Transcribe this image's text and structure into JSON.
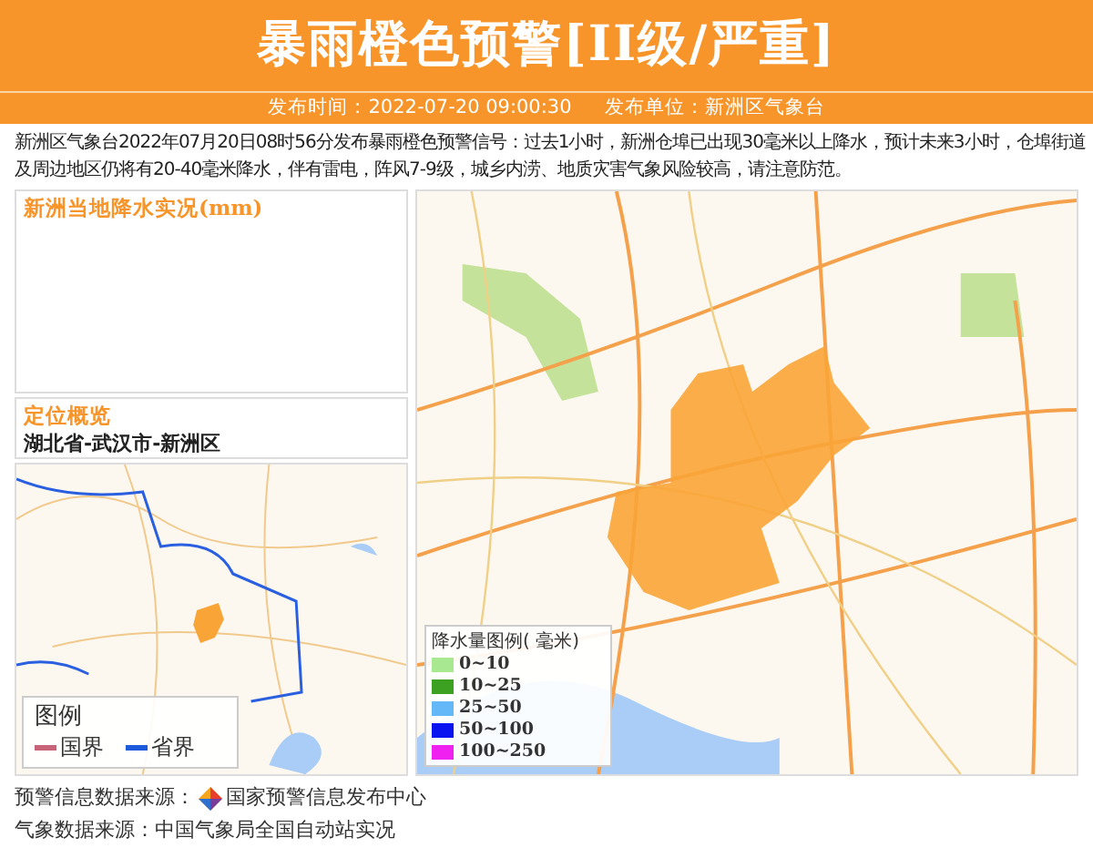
{
  "header": {
    "title": "暴雨橙色预警[II级/严重]",
    "issue_time": "发布时间：2022-07-20 09:00:30",
    "issuer": "发布单位：新洲区气象台"
  },
  "description": "新洲区气象台2022年07月20日08时56分发布暴雨橙色预警信号：过去1小时，新洲仓埠已出现30毫米以上降水，预计未来3小时，仓埠街道及周边地区仍将有20-40毫米降水，伴有雷电，阵风7-9级，城乡内涝、地质灾害气象风险较高，请注意防范。",
  "rainfall_panel": {
    "title": "新洲当地降水实况(mm)"
  },
  "location_panel": {
    "title": "定位概览",
    "location": "湖北省-武汉市-新洲区"
  },
  "overview_legend": {
    "title": "图例",
    "items": [
      {
        "label": "国界",
        "color": "#c86478"
      },
      {
        "label": "省界",
        "color": "#1e5adc"
      }
    ]
  },
  "rain_legend": {
    "title": "降水量图例( 毫米)",
    "items": [
      {
        "label": "0~10",
        "color": "#a8e890"
      },
      {
        "label": "10~25",
        "color": "#3ca020"
      },
      {
        "label": "25~50",
        "color": "#64b8f8"
      },
      {
        "label": "50~100",
        "color": "#0a14f0"
      },
      {
        "label": "100~250",
        "color": "#f020f0"
      }
    ]
  },
  "footer": {
    "warning_source_label": "预警信息数据来源：",
    "warning_source": "国家预警信息发布中心",
    "weather_source": "气象数据来源：中国气象局全国自动站实况"
  }
}
